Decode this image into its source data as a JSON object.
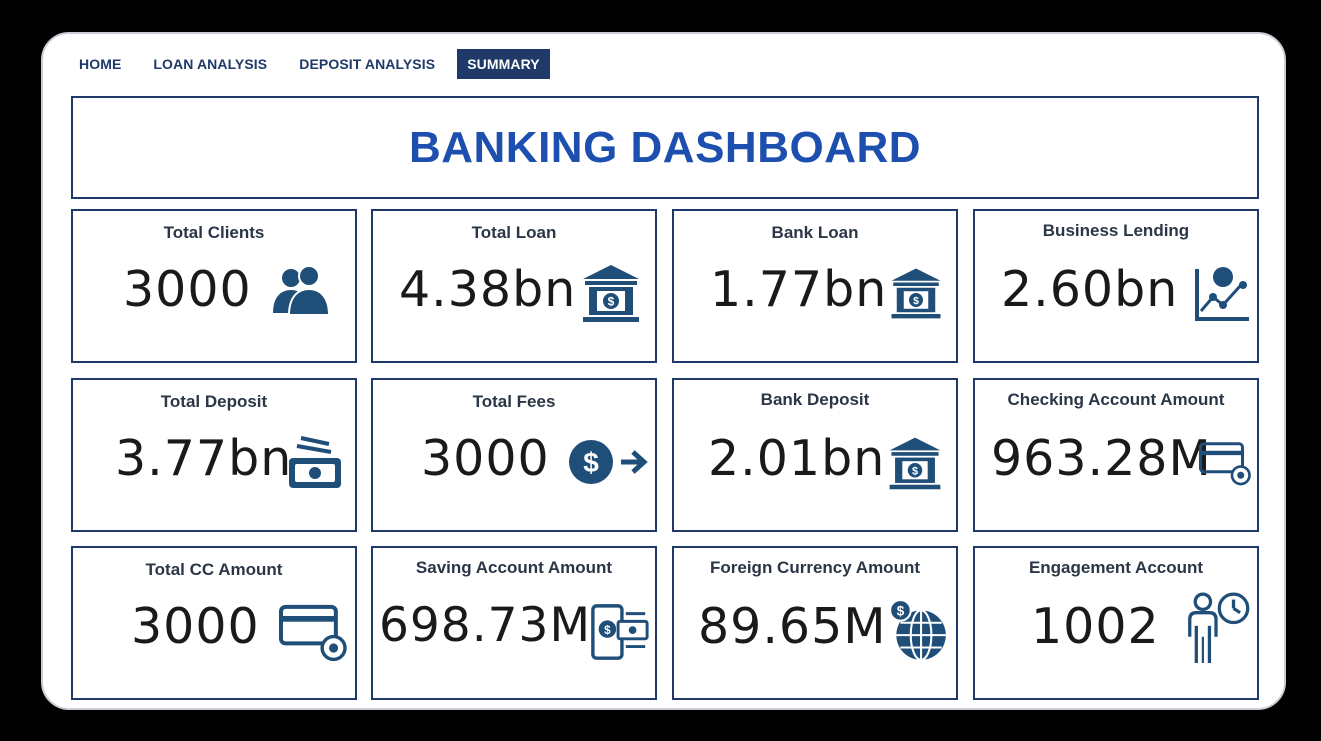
{
  "nav": {
    "tabs": [
      "HOME",
      "LOAN ANALYSIS",
      "DEPOSIT ANALYSIS",
      "SUMMARY"
    ],
    "active": "SUMMARY"
  },
  "banner": {
    "title": "BANKING DASHBOARD"
  },
  "colors": {
    "accent": "#1f3a68",
    "title": "#1c4fae",
    "icon": "#1f4e79"
  },
  "cards": [
    {
      "label": "Total Clients",
      "value": "3000",
      "icon": "users-icon"
    },
    {
      "label": "Total Loan",
      "value": "4.38bn",
      "icon": "bank-icon"
    },
    {
      "label": "Bank Loan",
      "value": "1.77bn",
      "icon": "bank-icon"
    },
    {
      "label": "Business Lending",
      "value": "2.60bn",
      "icon": "business-growth-icon"
    },
    {
      "label": "Total Deposit",
      "value": "3.77bn",
      "icon": "cash-deposit-icon"
    },
    {
      "label": "Total Fees",
      "value": "3000",
      "icon": "dollar-arrow-icon"
    },
    {
      "label": "Bank Deposit",
      "value": "2.01bn",
      "icon": "bank-icon"
    },
    {
      "label": "Checking Account Amount",
      "value": "963.28M",
      "icon": "card-gear-icon"
    },
    {
      "label": "Total CC Amount",
      "value": "3000",
      "icon": "card-gear-icon"
    },
    {
      "label": "Saving Account Amount",
      "value": "698.73M",
      "icon": "mobile-money-icon"
    },
    {
      "label": "Foreign Currency Amount",
      "value": "89.65M",
      "icon": "globe-dollar-icon"
    },
    {
      "label": "Engagement Account",
      "value": "1002",
      "icon": "person-clock-icon"
    }
  ]
}
